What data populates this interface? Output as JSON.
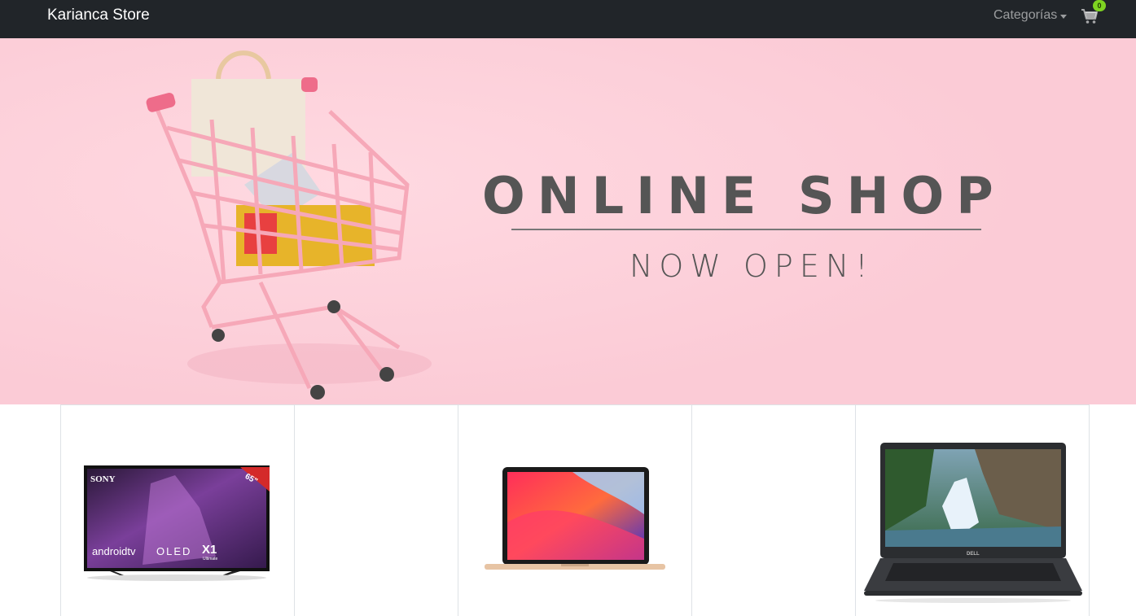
{
  "navbar": {
    "brand": "Karianca Store",
    "categories_label": "Categorías",
    "cart_count": "0",
    "badge_color": "#7ed321"
  },
  "hero": {
    "title": "ONLINE SHOP",
    "subtitle": "NOW OPEN!",
    "background_color": "#fbcbd6"
  },
  "products": [
    {
      "name": "tv-product",
      "image": "sony-oled-tv",
      "tv_brand": "SONY",
      "tv_size": "65\"",
      "tv_os": "androidtv",
      "tv_panel": "OLED",
      "tv_chip": "X1",
      "tv_chip_sub": "Ultimate"
    },
    {
      "name": "empty-product",
      "image": ""
    },
    {
      "name": "laptop-product",
      "image": "macbook-air"
    },
    {
      "name": "empty-product",
      "image": ""
    },
    {
      "name": "laptop-product",
      "image": "dell-laptop",
      "laptop_brand": "DELL"
    }
  ]
}
